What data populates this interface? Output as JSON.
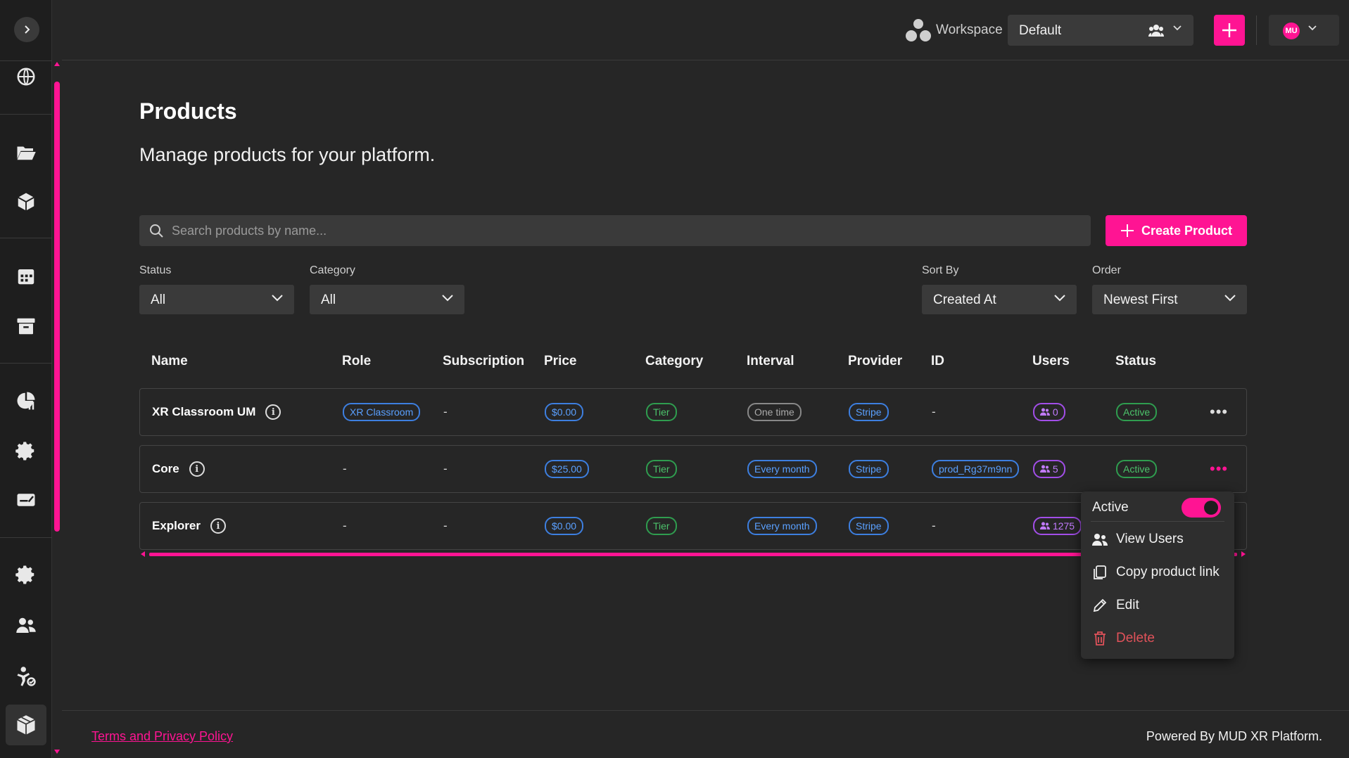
{
  "topbar": {
    "workspace_label": "Workspace",
    "workspace_value": "Default",
    "avatar_initials": "MU"
  },
  "page": {
    "title": "Products",
    "subtitle": "Manage products for your platform."
  },
  "search": {
    "placeholder": "Search products by name..."
  },
  "create_button": "Create Product",
  "filters": {
    "status": {
      "label": "Status",
      "value": "All"
    },
    "category": {
      "label": "Category",
      "value": "All"
    },
    "sort_by": {
      "label": "Sort By",
      "value": "Created At"
    },
    "order": {
      "label": "Order",
      "value": "Newest First"
    }
  },
  "table": {
    "headers": [
      "Name",
      "Role",
      "Subscription",
      "Price",
      "Category",
      "Interval",
      "Provider",
      "ID",
      "Users",
      "Status"
    ],
    "rows": [
      {
        "name": "XR Classroom UM",
        "role": "XR Classroom",
        "subscription": "-",
        "price": "$0.00",
        "category": "Tier",
        "interval": "One time",
        "provider": "Stripe",
        "id": "-",
        "users": "0",
        "status": "Active"
      },
      {
        "name": "Core",
        "role": "-",
        "subscription": "-",
        "price": "$25.00",
        "category": "Tier",
        "interval": "Every month",
        "provider": "Stripe",
        "id": "prod_Rg37m9nn",
        "users": "5",
        "status": "Active"
      },
      {
        "name": "Explorer",
        "role": "-",
        "subscription": "-",
        "price": "$0.00",
        "category": "Tier",
        "interval": "Every month",
        "provider": "Stripe",
        "id": "-",
        "users": "1275",
        "status": ""
      }
    ]
  },
  "context_menu": {
    "active_label": "Active",
    "active_on": true,
    "view_users": "View Users",
    "copy_link": "Copy product link",
    "edit": "Edit",
    "delete": "Delete"
  },
  "footer": {
    "terms": "Terms and Privacy Policy",
    "powered": "Powered By MUD XR Platform."
  },
  "colors": {
    "accent": "#ff1493",
    "background": "#262626",
    "sidebar": "#1e1e1e",
    "pill_blue": "#5aa0ff",
    "pill_green": "#4cc36b",
    "pill_purple": "#c27bff",
    "danger": "#e0525a"
  },
  "icons": {
    "sidebar": [
      "expand-chevron-icon",
      "globe-icon",
      "folder-open-icon",
      "cube-icon",
      "calendar-icon",
      "archive-icon",
      "chart-pie-icon",
      "gear-icon",
      "id-card-icon",
      "settings-gear-icon",
      "users-icon",
      "child-check-icon",
      "boxes-icon"
    ]
  }
}
